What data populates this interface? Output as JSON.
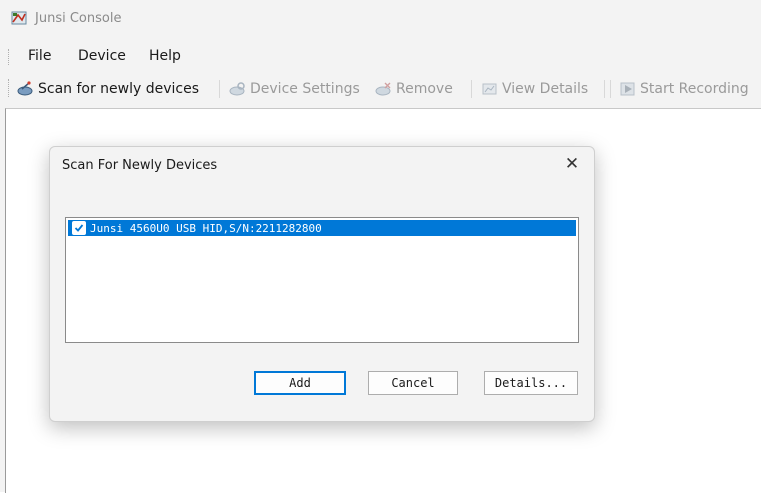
{
  "window": {
    "title": "Junsi Console"
  },
  "menu": {
    "file": "File",
    "device": "Device",
    "help": "Help"
  },
  "toolbar": {
    "scan": "Scan for newly devices",
    "device_settings": "Device Settings",
    "remove": "Remove",
    "view_details": "View Details",
    "start_recording": "Start Recording"
  },
  "dialog": {
    "title": "Scan For Newly Devices",
    "close": "✕",
    "devices": [
      {
        "label": "Junsi 4560U0 USB HID,S/N:2211282800",
        "checked": true,
        "selected": true
      }
    ],
    "buttons": {
      "add": "Add",
      "cancel": "Cancel",
      "details": "Details..."
    }
  },
  "colors": {
    "selection": "#0078d7",
    "disabled_text": "#9a9a9a"
  }
}
